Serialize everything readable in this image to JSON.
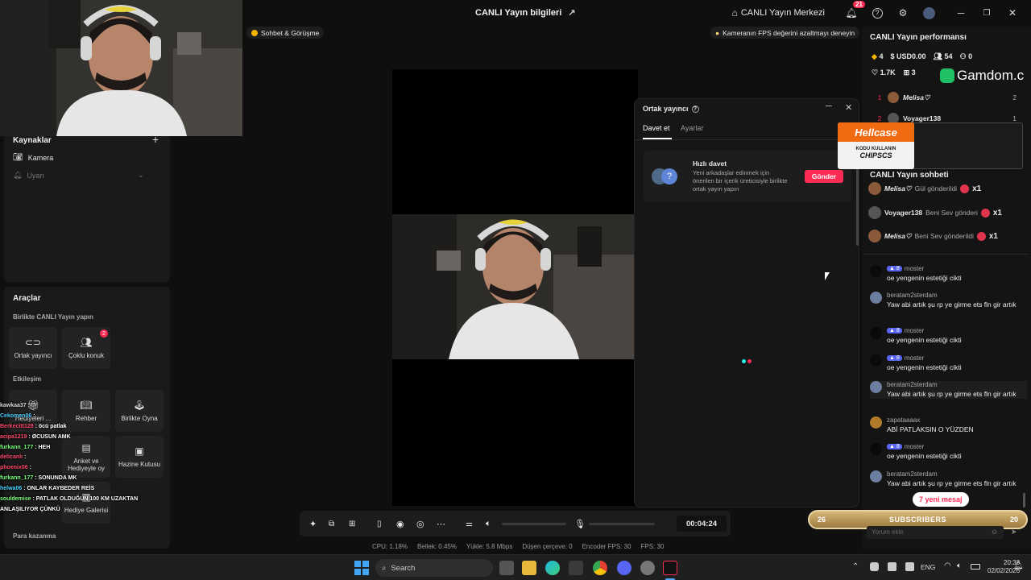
{
  "window": {
    "title": "CANLI Yayın bilgileri",
    "live_center": "CANLI Yayın Merkezi",
    "notif_count": "21"
  },
  "top_pills": {
    "chat_pill": "Sohbet & Görüşme",
    "fps_tip": "Kameranın FPS değerini azaltmayı deneyin"
  },
  "sources": {
    "title": "Kaynaklar",
    "items": [
      "Kamera",
      "Uyarı"
    ]
  },
  "tools": {
    "title": "Araçlar",
    "together_title": "Birlikte CANLI Yayın yapın",
    "cohost_label": "Ortak yayıncı",
    "multi_guest_label": "Çoklu konuk",
    "multi_guest_badge": "2",
    "interaction_title": "Etkileşim",
    "gift_label": "Hediyeleri ...",
    "guide_label": "Rehber",
    "play_together_label": "Birlikte Oyna",
    "poll_label": "Anket ve Hediyeyle oy",
    "treasure_label": "Hazine Kutusu",
    "gift_gallery_label": "Hediye Galerisi",
    "earn_title": "Para kazanma"
  },
  "cohost_popup": {
    "title": "Ortak yayıncı",
    "tab_invite": "Davet et",
    "tab_settings": "Ayarlar",
    "quick_invite_title": "Hızlı davet",
    "quick_invite_desc": "Yeni arkadaşlar edinmek için önerilen bir içerik üreticisiyle birlikte ortak yayın yapın",
    "send_button": "Gönder"
  },
  "controls": {
    "timer": "00:04:24"
  },
  "stats": {
    "cpu": "CPU: 1.18%",
    "memory": "Bellek: 0.45%",
    "upload": "Yükle: 5.8 Mbps",
    "dropped": "Düşen çerçeve: 0",
    "encoder_fps": "Encoder FPS: 30",
    "fps": "FPS: 30"
  },
  "performance": {
    "title": "CANLI Yayın performansı",
    "coins": "4",
    "usd": "USD0.00",
    "viewers": "54",
    "new_followers": "0",
    "likes": "1.7K",
    "gifts": "3",
    "gamdom": "Gamdom.c",
    "ranking": [
      {
        "rank": "1",
        "name": "Melisa♡",
        "value": "2"
      },
      {
        "rank": "2",
        "name": "Voyager138",
        "value": "1"
      }
    ]
  },
  "hellcase": {
    "brand": "Hellcase",
    "line1": "KODU KULLANIN",
    "line2": "CHIPSCS"
  },
  "live_chat": {
    "title": "CANLI Yayın sohbeti",
    "gifts": [
      {
        "user": "Melisa♡",
        "text": "Gül gönderildi",
        "count": "x1"
      },
      {
        "user": "Voyager138",
        "text": "Beni Sev gönderi",
        "count": "x1"
      },
      {
        "user": "Melisa♡",
        "text": "Beni Sev gönderildi",
        "count": "x1"
      }
    ],
    "messages": [
      {
        "level": "8",
        "user": "moster",
        "text": "oe yengenin estetiği cikti"
      },
      {
        "level": "",
        "user": "beratam2sterdam",
        "text": "Yaw abi artık şu rp ye girme ets fln gir artık"
      },
      {
        "level": "8",
        "user": "moster",
        "text": "oe yengenin estetiği cikti"
      },
      {
        "level": "8",
        "user": "moster",
        "text": "oe yengenin estetiği cikti"
      },
      {
        "level": "",
        "user": "beratam2sterdam",
        "text": "Yaw abi artık şu rp ye girme ets fln gir artık"
      },
      {
        "level": "",
        "user": "zapataaaax",
        "text": "ABİ PATLAKSIN O YÜZDEN"
      },
      {
        "level": "8",
        "user": "moster",
        "text": "oe yengenin estetiği cikti"
      },
      {
        "level": "",
        "user": "beratam2sterdam",
        "text": "Yaw abi artık şu rp ye girme ets fln gir artık"
      }
    ],
    "new_messages": "7 yeni mesaj",
    "comment_placeholder": "Yorum ekle"
  },
  "sub_bar": {
    "left": "26",
    "label": "SUBSCRIBERS",
    "right": "20"
  },
  "overlay_chat": [
    {
      "user": "kawkaa37",
      "text": ":",
      "color": "#d9d9d9"
    },
    {
      "user": "Cekomen06",
      "text": ":",
      "color": "#4fd1ff"
    },
    {
      "user": "Berkecitt128",
      "text": ": öcü patlak",
      "color": "#ff4d6d"
    },
    {
      "user": "acipa1219",
      "text": ": ØCUSUN AMK",
      "color": "#ff4d6d"
    },
    {
      "user": "furkann_177",
      "text": ": HEH",
      "color": "#7cff7c"
    },
    {
      "user": "delicanlı",
      "text": ":",
      "color": "#ff4d6d"
    },
    {
      "user": "phoenix06",
      "text": ":",
      "color": "#ff4d6d"
    },
    {
      "user": "furkann_177",
      "text": ": SONUNDA MK",
      "color": "#7cff7c"
    },
    {
      "user": "helwa06",
      "text": ": ONLAR KAYBEDER REİS",
      "color": "#4fd1ff"
    },
    {
      "user": "souldemise",
      "text": ": PATLAK OLDUĞUN 100 KM UZAKTAN",
      "color": "#7cff7c"
    },
    {
      "user": "",
      "text": "ANLAŞILIYOR ÇÜNKÜ",
      "color": "#ffffff"
    }
  ],
  "taskbar": {
    "search_placeholder": "Search",
    "lang": "ENG",
    "time": "20:38",
    "date": "02/02/2026"
  }
}
